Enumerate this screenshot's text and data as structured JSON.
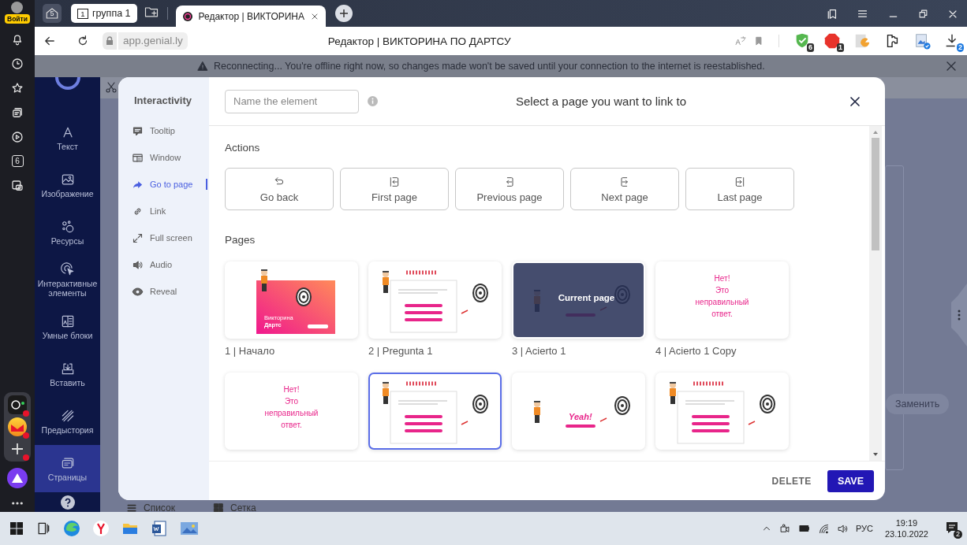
{
  "browser": {
    "profile_badge": "Войти",
    "home_count": "5",
    "tab_group": {
      "count": "1",
      "label": "группа 1"
    },
    "tabs": [
      {
        "title": "Редактор | ВИКТОРИНА",
        "selected": true
      }
    ],
    "url": "app.genial.ly",
    "page_title": "Редактор | ВИКТОРИНА ПО ДАРТСУ",
    "extensions": [
      {
        "kind": "shield",
        "badge": "6"
      },
      {
        "kind": "adblock",
        "badge": "1"
      },
      {
        "kind": "pacman"
      },
      {
        "kind": "puzzle"
      },
      {
        "kind": "image"
      },
      {
        "kind": "download",
        "badge": "2"
      }
    ],
    "sidebar_counter": "6"
  },
  "banner": {
    "text": "Reconnecting... You're offline right now, so changes made won't be saved until your connection to the internet is reestablished."
  },
  "editor_sidebar": {
    "items": [
      {
        "kind": "text",
        "label": "Текст",
        "selected": false
      },
      {
        "kind": "image",
        "label": "Изображение",
        "selected": false
      },
      {
        "kind": "resources",
        "label": "Ресурсы",
        "selected": false
      },
      {
        "kind": "interactive",
        "label": "Интерактивные элементы",
        "selected": false
      },
      {
        "kind": "blocks",
        "label": "Умные блоки",
        "selected": false
      },
      {
        "kind": "insert",
        "label": "Вставить",
        "selected": false
      },
      {
        "kind": "background",
        "label": "Предыстория",
        "selected": false
      },
      {
        "kind": "pages",
        "label": "Страницы",
        "selected": true
      }
    ]
  },
  "background": {
    "view_options": [
      "Список",
      "Сетка"
    ],
    "replace_button": "Заменить"
  },
  "dialog": {
    "panel_title": "Interactivity",
    "options": [
      {
        "kind": "tooltip",
        "label": "Tooltip",
        "selected": false
      },
      {
        "kind": "window",
        "label": "Window",
        "selected": false
      },
      {
        "kind": "goto",
        "label": "Go to page",
        "selected": true
      },
      {
        "kind": "link",
        "label": "Link",
        "selected": false
      },
      {
        "kind": "fullscreen",
        "label": "Full screen",
        "selected": false
      },
      {
        "kind": "audio",
        "label": "Audio",
        "selected": false
      },
      {
        "kind": "reveal",
        "label": "Reveal",
        "selected": false
      }
    ],
    "name_field": {
      "placeholder": "Name the element"
    },
    "title": "Select a page you want to link to",
    "actions_heading": "Actions",
    "actions": [
      {
        "kind": "back",
        "label": "Go back"
      },
      {
        "kind": "first",
        "label": "First page"
      },
      {
        "kind": "previous",
        "label": "Previous page"
      },
      {
        "kind": "next",
        "label": "Next page"
      },
      {
        "kind": "last",
        "label": "Last page"
      }
    ],
    "pages_heading": "Pages",
    "pages": [
      {
        "kind": "intro",
        "label": "1 | Начало",
        "texts": [
          "Викторина",
          "Дартс"
        ],
        "selected": false,
        "current": false
      },
      {
        "kind": "question",
        "label": "2 | Pregunta 1",
        "selected": false,
        "current": false
      },
      {
        "kind": "yeah",
        "label": "3 | Acierto 1",
        "overlay": "Current page",
        "selected": false,
        "current": true
      },
      {
        "kind": "wrong",
        "label": "4 | Acierto 1 Copy",
        "texts": [
          "Нет!",
          "Это",
          "неправильный",
          "ответ."
        ],
        "selected": false,
        "current": false
      },
      {
        "kind": "wrong",
        "texts": [
          "Нет!",
          "Это",
          "неправильный",
          "ответ."
        ],
        "selected": false,
        "current": false
      },
      {
        "kind": "question",
        "selected": true,
        "current": false
      },
      {
        "kind": "yeah",
        "texts": [
          "Yeah!"
        ],
        "selected": false,
        "current": false
      },
      {
        "kind": "question",
        "selected": false,
        "current": false
      }
    ],
    "buttons": {
      "delete": "DELETE",
      "save": "SAVE"
    }
  },
  "taskbar": {
    "language": "РУС",
    "time": "19:19",
    "date": "23.10.2022",
    "notifications": "2"
  }
}
